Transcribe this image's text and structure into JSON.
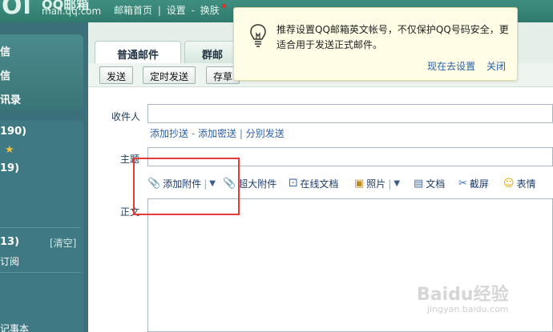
{
  "brand": {
    "logo_text": "QQ邮箱",
    "domain": "mail.qq.com"
  },
  "toplinks": {
    "home": "邮箱首页",
    "sep": "|",
    "settings": "设置",
    "dash": "-",
    "skin": "换肤"
  },
  "sidebar": {
    "items": [
      {
        "label": "信"
      },
      {
        "label": "信"
      },
      {
        "label": "讯录"
      },
      {
        "label": "190)"
      },
      {
        "label": "★"
      },
      {
        "label": "19)"
      },
      {
        "label": "13)"
      },
      {
        "label": "订阅"
      },
      {
        "label": "记事本"
      }
    ],
    "clear": "[清空]"
  },
  "tabs": [
    "普通邮件",
    "群邮"
  ],
  "toolbar": {
    "send": "发送",
    "timed_send": "定时发送",
    "draft": "存草"
  },
  "compose": {
    "to_label": "收件人",
    "cc_link": "添加抄送",
    "dash": "-",
    "bcc_link": "添加密送",
    "pipe": "|",
    "separate_link": "分别发送",
    "subject_label": "主题",
    "body_label": "正文"
  },
  "attach_bar": {
    "add_attachment": "添加附件",
    "large_attachment": "超大附件",
    "online_doc": "在线文档",
    "photo": "照片",
    "document": "文档",
    "screenshot": "截屏",
    "emoji": "表情"
  },
  "tip": {
    "text": "推荐设置QQ邮箱英文帐号，不仅保护QQ号码安全，更适合用于发送正式邮件。",
    "setup_now": "现在去设置",
    "close": "关闭"
  },
  "watermark": {
    "text": "Baidu经验",
    "url": "jingyan.baidu.com"
  },
  "colors": {
    "accent": "#3b7f72",
    "highlight_border": "#e53a3a",
    "link": "#2860a8"
  }
}
